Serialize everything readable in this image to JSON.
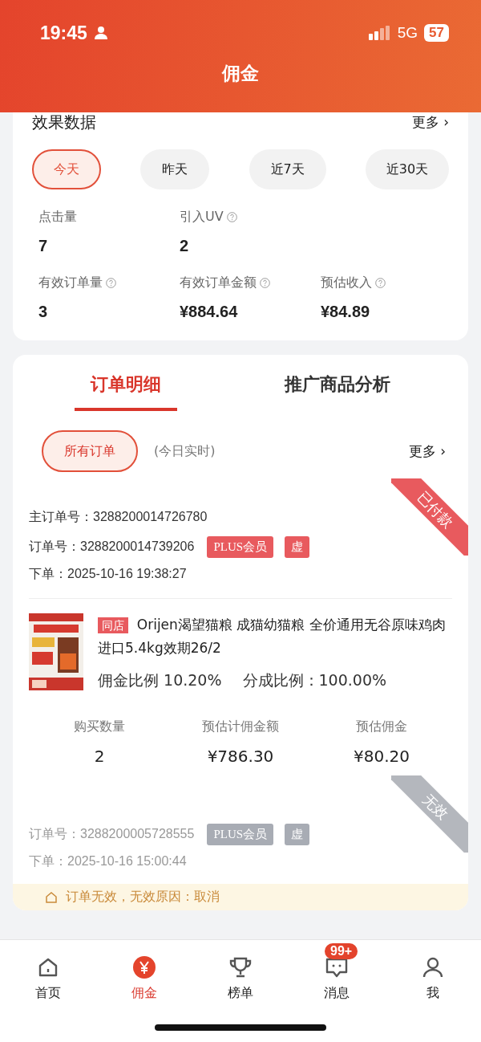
{
  "status_bar": {
    "time": "19:45",
    "network": "5G",
    "battery": "57"
  },
  "header": {
    "title": "佣金"
  },
  "stats_card": {
    "title": "效果数据",
    "more": "更多",
    "chevron": "›",
    "ranges": [
      {
        "label": "今天",
        "selected": true
      },
      {
        "label": "昨天",
        "selected": false
      },
      {
        "label": "近7天",
        "selected": false
      },
      {
        "label": "近30天",
        "selected": false
      }
    ],
    "metrics": [
      {
        "label": "点击量",
        "value": "7",
        "help": false
      },
      {
        "label": "引入UV",
        "value": "2",
        "help": true
      },
      {
        "label": "有效订单量",
        "value": "3",
        "help": true
      },
      {
        "label": "有效订单金额",
        "value": "¥884.64",
        "help": true
      },
      {
        "label": "预估收入",
        "value": "¥84.89",
        "help": true
      }
    ]
  },
  "orders_card": {
    "tabs": [
      {
        "label": "订单明细",
        "selected": true
      },
      {
        "label": "推广商品分析",
        "selected": false
      }
    ],
    "filter": {
      "label": "所有订单",
      "note": "(今日实时)",
      "more": "更多",
      "chevron": "›"
    },
    "orders": [
      {
        "status": "已付款",
        "valid": true,
        "main_order": "主订单号：3288200014726780",
        "order_no": "订单号：3288200014739206",
        "tags": [
          "PLUS会员",
          "虚"
        ],
        "placed": "下单：2025-10-16 19:38:27",
        "product": {
          "shop_tag": "同店",
          "title": "Orijen渴望猫粮 成猫幼猫粮 全价通用无谷原味鸡肉进口5.4kg效期26/2",
          "commission_rate": "佣金比例 10.20%",
          "share_rate": "分成比例：100.00%"
        },
        "figures": [
          {
            "label": "购买数量",
            "value": "2"
          },
          {
            "label": "预估计佣金额",
            "value": "¥786.30"
          },
          {
            "label": "预估佣金",
            "value": "¥80.20"
          }
        ]
      },
      {
        "status": "无效",
        "valid": false,
        "order_no": "订单号：3288200005728555",
        "tags": [
          "PLUS会员",
          "虚"
        ],
        "placed": "下单：2025-10-16 15:00:44",
        "notice": "订单无效，无效原因：取消"
      }
    ]
  },
  "tab_bar": [
    {
      "label": "首页",
      "selected": false
    },
    {
      "label": "佣金",
      "selected": true
    },
    {
      "label": "榜单",
      "selected": false
    },
    {
      "label": "消息",
      "selected": false,
      "badge": "99+"
    },
    {
      "label": "我",
      "selected": false
    }
  ]
}
